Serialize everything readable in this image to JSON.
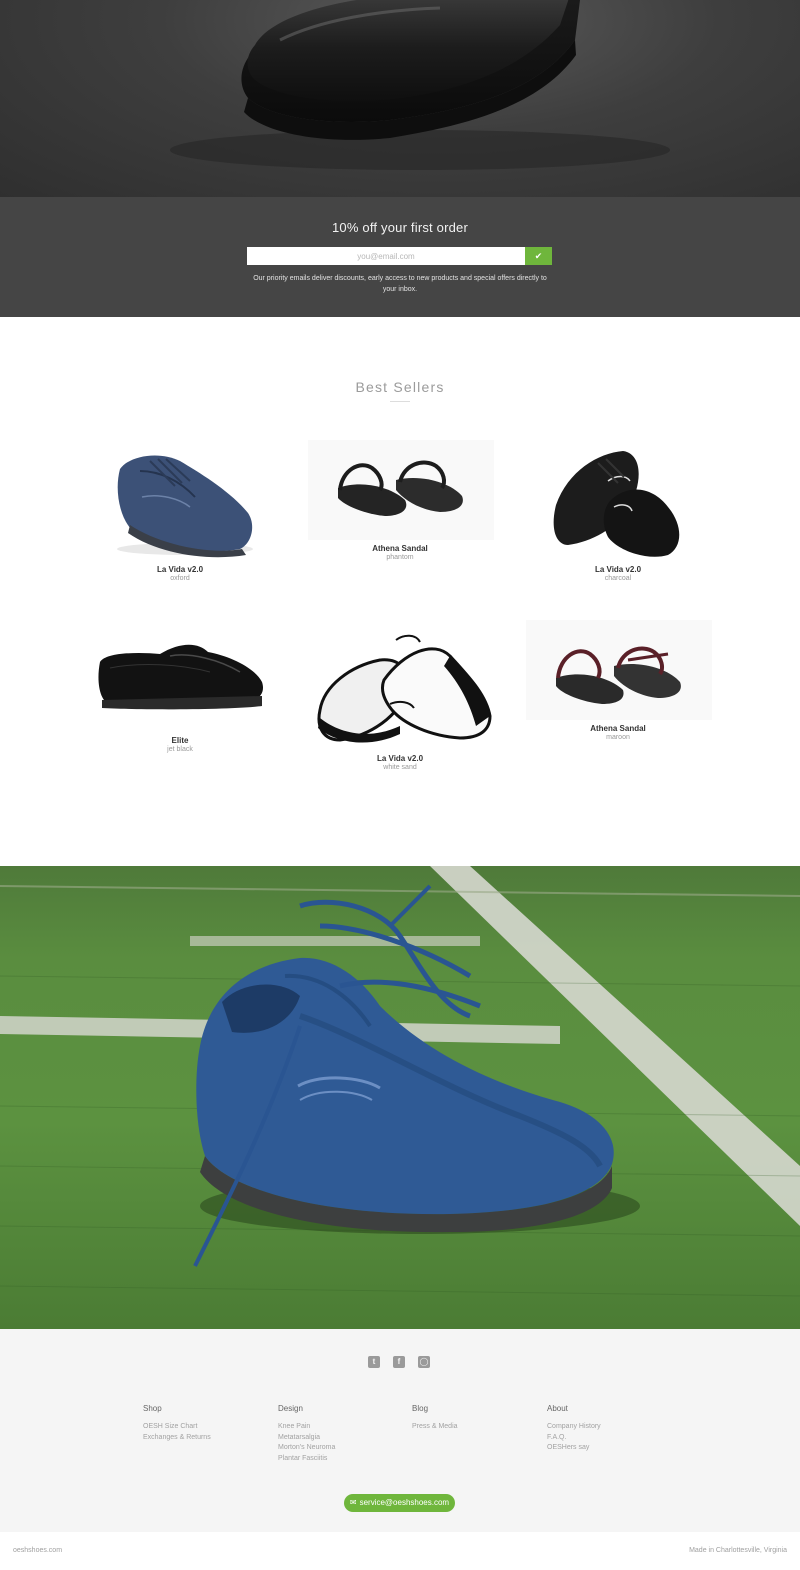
{
  "newsletter": {
    "title": "10% off your first order",
    "email_placeholder": "you@email.com",
    "submit_icon": "check-icon",
    "description": "Our priority emails deliver discounts, early access to new products and special offers directly to your inbox."
  },
  "best_sellers": {
    "title": "Best Sellers",
    "products": [
      {
        "name": "La Vida v2.0",
        "variant": "oxford"
      },
      {
        "name": "Athena Sandal",
        "variant": "phantom"
      },
      {
        "name": "La Vida v2.0",
        "variant": "charcoal"
      },
      {
        "name": "Elite",
        "variant": "jet black"
      },
      {
        "name": "La Vida v2.0",
        "variant": "white sand"
      },
      {
        "name": "Athena Sandal",
        "variant": "maroon"
      }
    ]
  },
  "footer": {
    "social": [
      "twitter-icon",
      "facebook-icon",
      "instagram-icon"
    ],
    "columns": [
      {
        "heading": "Shop",
        "links": [
          "OESH Size Chart",
          "Exchanges & Returns"
        ]
      },
      {
        "heading": "Design",
        "links": [
          "Knee Pain",
          "Metatarsalgia",
          "Morton's Neuroma",
          "Plantar Fasciitis"
        ]
      },
      {
        "heading": "Blog",
        "links": [
          "Press & Media"
        ]
      },
      {
        "heading": "About",
        "links": [
          "Company History",
          "F.A.Q.",
          "OESHers say"
        ]
      }
    ],
    "email": "service@oeshshoes.com",
    "domain": "oeshshoes.com",
    "made_in": "Made in Charlottesville, Virginia"
  },
  "colors": {
    "accent_green": "#6fb63c",
    "newsletter_bg": "#454545",
    "footer_bg": "#f5f5f5"
  }
}
